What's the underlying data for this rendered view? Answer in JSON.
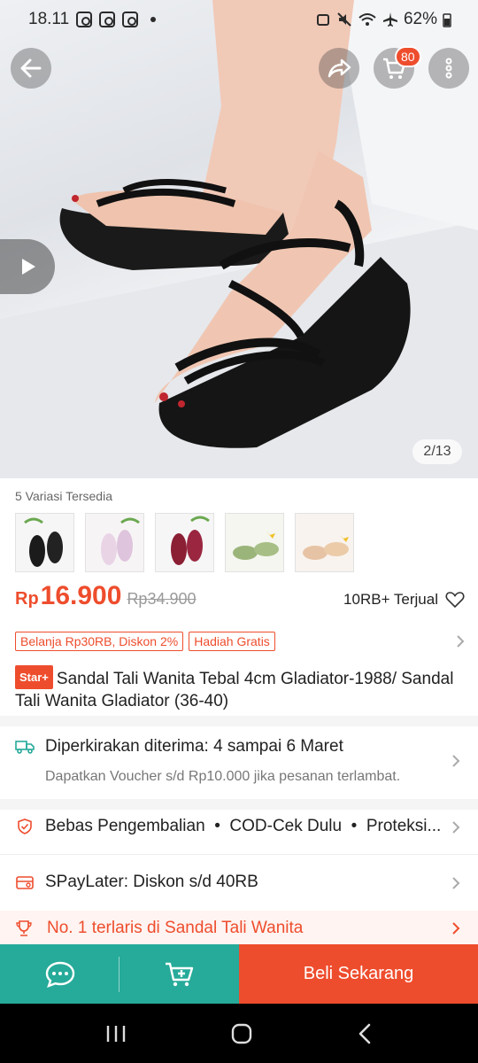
{
  "status_bar": {
    "time": "18.11",
    "battery": "62%"
  },
  "header": {
    "cart_count": "80"
  },
  "gallery": {
    "counter": "2/13"
  },
  "variants": {
    "label": "5 Variasi Tersedia"
  },
  "price": {
    "currency": "Rp",
    "value": "16.900",
    "original": "Rp34.900",
    "sold": "10RB+ Terjual"
  },
  "promos": [
    "Belanja Rp30RB, Diskon 2%",
    "Hadiah Gratis"
  ],
  "product": {
    "badge": "Star+",
    "title": "Sandal Tali Wanita Tebal 4cm Gladiator-1988/ Sandal Tali Wanita Gladiator (36-40)"
  },
  "shipping": {
    "estimate": "Diperkirakan diterima: 4 sampai 6 Maret",
    "voucher_note": "Dapatkan Voucher s/d Rp10.000 jika pesanan terlambat."
  },
  "guarantees": {
    "text": "Bebas Pengembalian  •  COD-Cek Dulu  •  Proteksi..."
  },
  "paylater": {
    "text": "SPayLater: Diskon s/d 40RB"
  },
  "bestseller": {
    "text": "No. 1 terlaris di Sandal Tali Wanita"
  },
  "bottom_bar": {
    "buy_label": "Beli Sekarang"
  },
  "colors": {
    "accent": "#ee4d2d",
    "teal": "#26aa99"
  }
}
